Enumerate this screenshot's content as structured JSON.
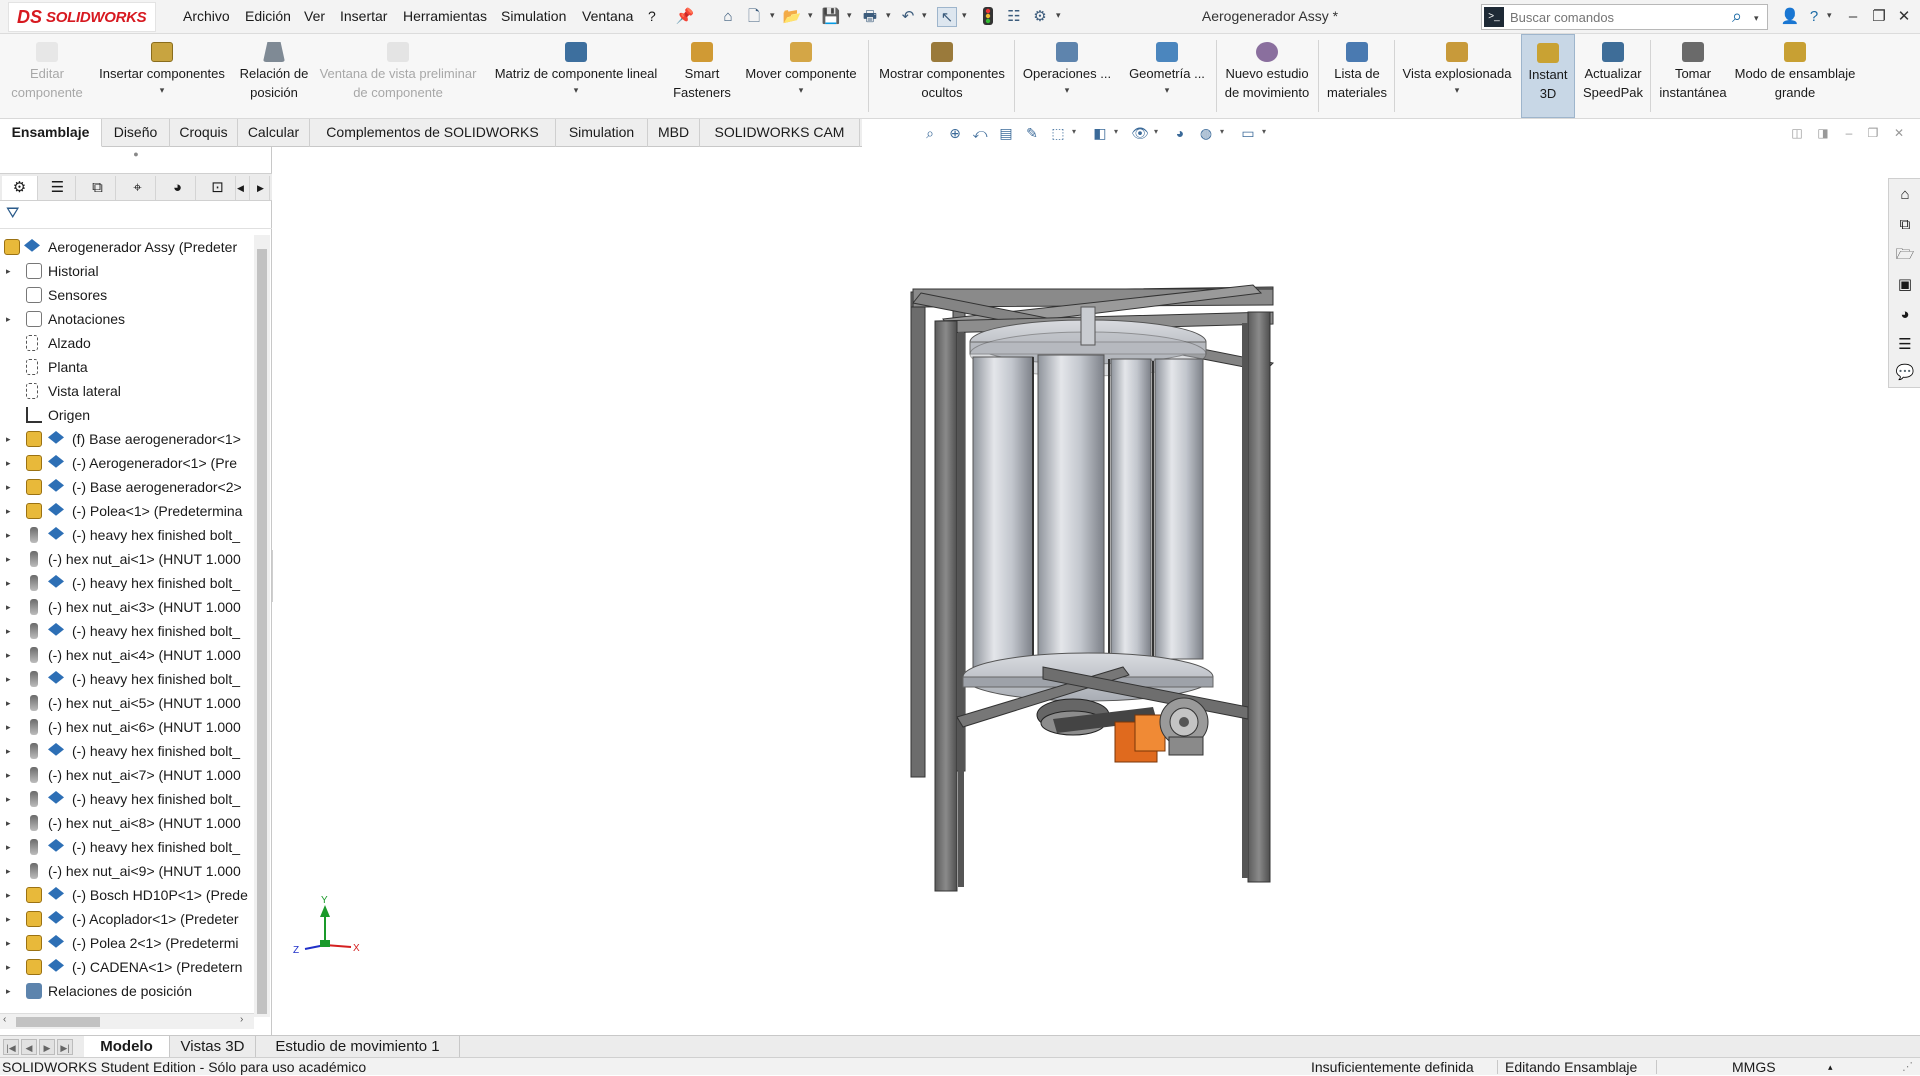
{
  "titlebar": {
    "logo_ds": "DS",
    "logo_text": "SOLIDWORKS",
    "menus": [
      "Archivo",
      "Edición",
      "Ver",
      "Insertar",
      "Herramientas",
      "Simulation",
      "Ventana",
      "?"
    ],
    "document_title": "Aerogenerador Assy *",
    "search_placeholder": "Buscar comandos"
  },
  "ribbon": {
    "editar_componente": "Editar componente",
    "insertar_componentes": "Insertar componentes",
    "relacion_posicion": "Relación de posición",
    "ventana_vista_preliminar": "Ventana de vista preliminar de componente",
    "matriz_lineal": "Matriz de componente lineal",
    "smart_fasteners": "Smart Fasteners",
    "mover_componente": "Mover componente",
    "mostrar_ocultos": "Mostrar componentes ocultos",
    "operaciones": "Operaciones ...",
    "geometria": "Geometría ...",
    "nuevo_estudio": "Nuevo estudio de movimiento",
    "lista_materiales": "Lista de materiales",
    "vista_explosionada": "Vista explosionada",
    "instant3d": "Instant 3D",
    "actualizar_speedpak": "Actualizar SpeedPak",
    "tomar_instantanea": "Tomar instantánea",
    "modo_ensamblaje_grande": "Modo de ensamblaje grande"
  },
  "cm_tabs": [
    "Ensamblaje",
    "Diseño",
    "Croquis",
    "Calcular",
    "Complementos de SOLIDWORKS",
    "Simulation",
    "MBD",
    "SOLIDWORKS CAM"
  ],
  "tree": {
    "root": "Aerogenerador Assy  (Predeter",
    "items": [
      {
        "label": "Historial",
        "kind": "history",
        "expand": true
      },
      {
        "label": "Sensores",
        "kind": "sensor",
        "expand": false
      },
      {
        "label": "Anotaciones",
        "kind": "annot",
        "expand": true
      },
      {
        "label": "Alzado",
        "kind": "plane",
        "expand": false
      },
      {
        "label": "Planta",
        "kind": "plane",
        "expand": false
      },
      {
        "label": "Vista lateral",
        "kind": "plane",
        "expand": false
      },
      {
        "label": "Origen",
        "kind": "origin",
        "expand": false
      },
      {
        "label": "(f) Base aerogenerador<1>",
        "kind": "comp",
        "expand": true
      },
      {
        "label": "(-) Aerogenerador<1> (Pre",
        "kind": "comp",
        "expand": true
      },
      {
        "label": "(-) Base aerogenerador<2>",
        "kind": "comp",
        "expand": true
      },
      {
        "label": "(-) Polea<1> (Predetermina",
        "kind": "comp",
        "expand": true
      },
      {
        "label": "(-) heavy hex finished bolt_",
        "kind": "bolt",
        "expand": true
      },
      {
        "label": "(-) hex nut_ai<1> (HNUT 1.000",
        "kind": "nut",
        "expand": true
      },
      {
        "label": "(-) heavy hex finished bolt_",
        "kind": "bolt",
        "expand": true
      },
      {
        "label": "(-) hex nut_ai<3> (HNUT 1.000",
        "kind": "nut",
        "expand": true
      },
      {
        "label": "(-) heavy hex finished bolt_",
        "kind": "bolt",
        "expand": true
      },
      {
        "label": "(-) hex nut_ai<4> (HNUT 1.000",
        "kind": "nut",
        "expand": true
      },
      {
        "label": "(-) heavy hex finished bolt_",
        "kind": "bolt",
        "expand": true
      },
      {
        "label": "(-) hex nut_ai<5> (HNUT 1.000",
        "kind": "nut",
        "expand": true
      },
      {
        "label": "(-) hex nut_ai<6> (HNUT 1.000",
        "kind": "nut",
        "expand": true
      },
      {
        "label": "(-) heavy hex finished bolt_",
        "kind": "bolt",
        "expand": true
      },
      {
        "label": "(-) hex nut_ai<7> (HNUT 1.000",
        "kind": "nut",
        "expand": true
      },
      {
        "label": "(-) heavy hex finished bolt_",
        "kind": "bolt",
        "expand": true
      },
      {
        "label": "(-) hex nut_ai<8> (HNUT 1.000",
        "kind": "nut",
        "expand": true
      },
      {
        "label": "(-) heavy hex finished bolt_",
        "kind": "bolt",
        "expand": true
      },
      {
        "label": "(-) hex nut_ai<9> (HNUT 1.000",
        "kind": "nut",
        "expand": true
      },
      {
        "label": "(-) Bosch HD10P<1> (Prede",
        "kind": "comp",
        "expand": true
      },
      {
        "label": "(-) Acoplador<1> (Predeter",
        "kind": "comp",
        "expand": true
      },
      {
        "label": "(-) Polea 2<1> (Predetermi",
        "kind": "comp",
        "expand": true
      },
      {
        "label": "(-) CADENA<1> (Predetern",
        "kind": "comp",
        "expand": true
      },
      {
        "label": "Relaciones de posición",
        "kind": "mates",
        "expand": true
      }
    ]
  },
  "triad": {
    "y": "Y",
    "x": "X",
    "z": "Z"
  },
  "bottom_tabs": [
    "Modelo",
    "Vistas 3D",
    "Estudio de movimiento 1"
  ],
  "status": {
    "edition": "SOLIDWORKS Student Edition - Sólo para uso académico",
    "definition": "Insuficientemente definida",
    "editing": "Editando Ensamblaje",
    "units": "MMGS"
  },
  "colors": {
    "brand_red": "#d71920",
    "accent_blue": "#1b6aa5",
    "instant3d_active": "#c8d7e6",
    "frame_gray": "#6e6e6e",
    "rotor_silver": "#b8bcc4",
    "motor_orange": "#e06a1e"
  }
}
